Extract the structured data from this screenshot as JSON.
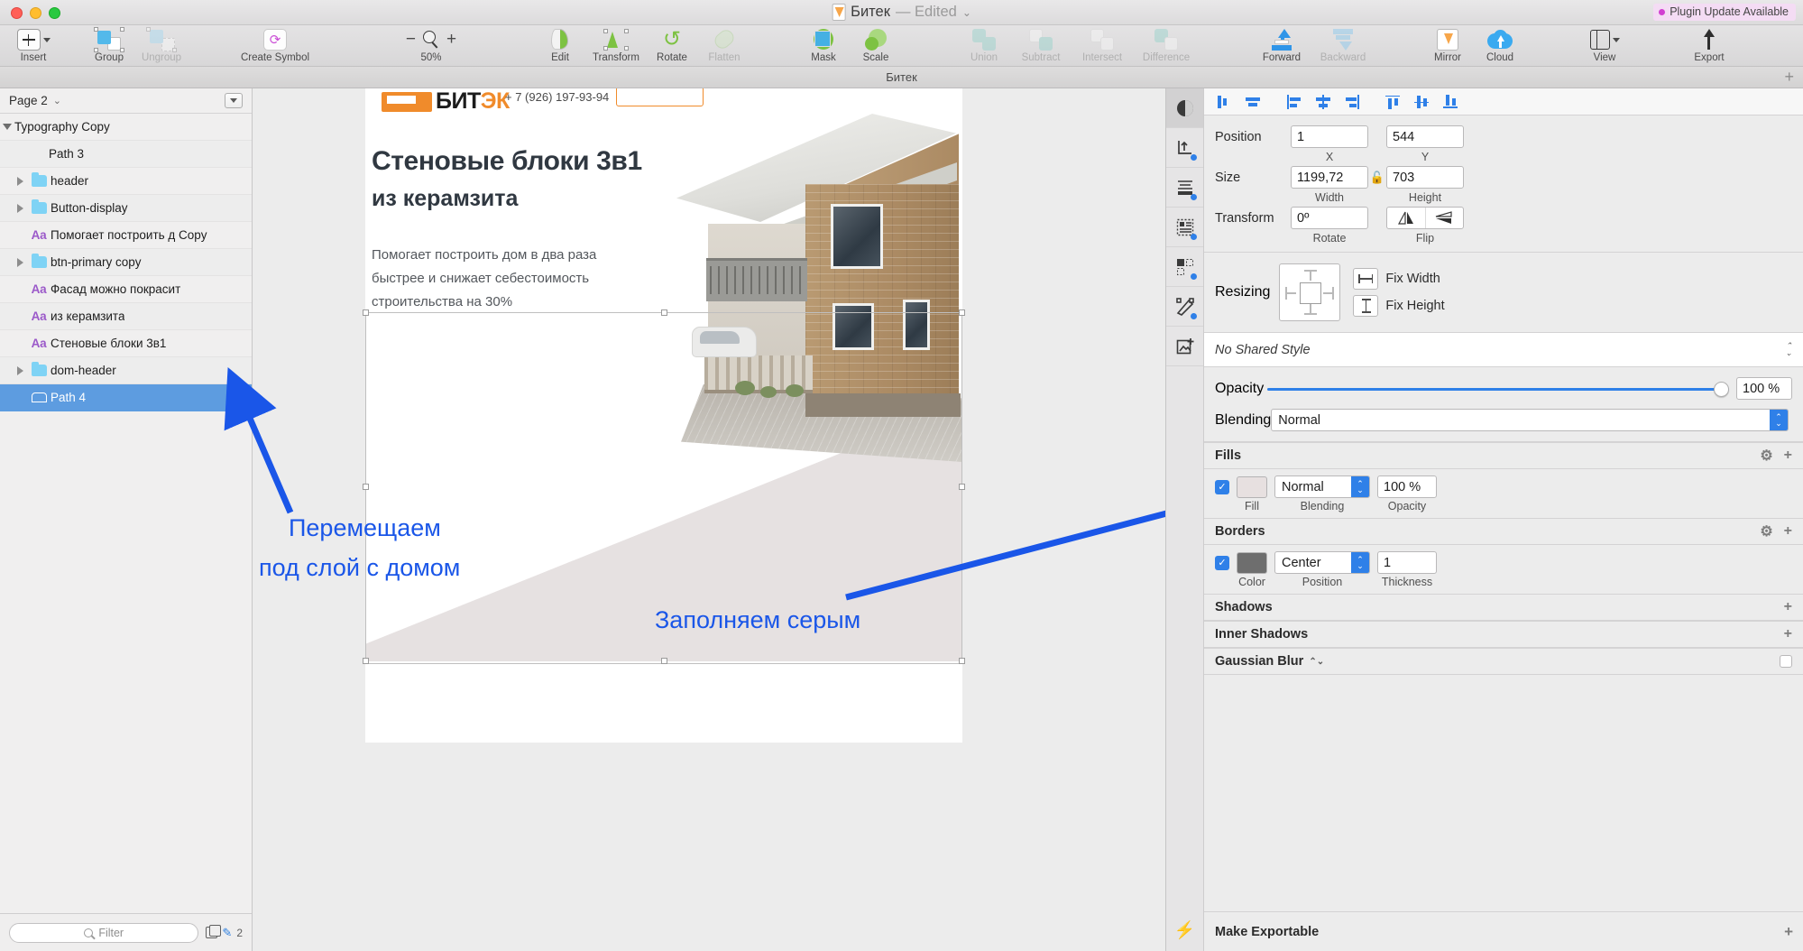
{
  "window": {
    "document_title": "Битек",
    "edited_label": "— Edited",
    "plugin_badge": "Plugin Update Available",
    "tab_label": "Битек"
  },
  "toolbar": {
    "items": [
      {
        "label": "Insert",
        "icon": "insert-plus-icon",
        "dim": false
      },
      {
        "label": "Group",
        "icon": "group-icon",
        "dim": false
      },
      {
        "label": "Ungroup",
        "icon": "ungroup-icon",
        "dim": true
      },
      {
        "label": "Create Symbol",
        "icon": "create-symbol-icon",
        "dim": false
      },
      {
        "label": "50%",
        "icon": "zoom-loupe-icon",
        "dim": false
      },
      {
        "label": "Edit",
        "icon": "edit-leaf-icon",
        "dim": false
      },
      {
        "label": "Transform",
        "icon": "transform-icon",
        "dim": false
      },
      {
        "label": "Rotate",
        "icon": "rotate-icon",
        "dim": false
      },
      {
        "label": "Flatten",
        "icon": "flatten-icon",
        "dim": true
      },
      {
        "label": "Mask",
        "icon": "mask-icon",
        "dim": false
      },
      {
        "label": "Scale",
        "icon": "scale-icon",
        "dim": false
      },
      {
        "label": "Union",
        "icon": "union-icon",
        "dim": true
      },
      {
        "label": "Subtract",
        "icon": "subtract-icon",
        "dim": true
      },
      {
        "label": "Intersect",
        "icon": "intersect-icon",
        "dim": true
      },
      {
        "label": "Difference",
        "icon": "difference-icon",
        "dim": true
      },
      {
        "label": "Forward",
        "icon": "forward-icon",
        "dim": false
      },
      {
        "label": "Backward",
        "icon": "backward-icon",
        "dim": true
      },
      {
        "label": "Mirror",
        "icon": "mirror-icon",
        "dim": false
      },
      {
        "label": "Cloud",
        "icon": "cloud-icon",
        "dim": false
      },
      {
        "label": "View",
        "icon": "view-icon",
        "dim": false
      },
      {
        "label": "Export",
        "icon": "export-icon",
        "dim": false
      }
    ],
    "zoom_level": "50%"
  },
  "sidebar": {
    "page_name": "Page 2",
    "filter_placeholder": "Filter",
    "filter_count": "2",
    "layers": [
      {
        "name": "Typography Copy",
        "type": "group",
        "expanded": true,
        "indent": 0,
        "selected": false
      },
      {
        "name": "Path 3",
        "type": "path-plain",
        "expanded": null,
        "indent": 1,
        "selected": false
      },
      {
        "name": "header",
        "type": "folder",
        "expanded": false,
        "indent": 1,
        "selected": false
      },
      {
        "name": "Button-display",
        "type": "folder",
        "expanded": false,
        "indent": 1,
        "selected": false
      },
      {
        "name": "Помогает построить д Copy",
        "type": "text",
        "expanded": null,
        "indent": 1,
        "selected": false
      },
      {
        "name": "btn-primary copy",
        "type": "folder",
        "expanded": false,
        "indent": 1,
        "selected": false
      },
      {
        "name": "Фасад можно покрасит",
        "type": "text",
        "expanded": null,
        "indent": 1,
        "selected": false
      },
      {
        "name": "из керамзита",
        "type": "text",
        "expanded": null,
        "indent": 1,
        "selected": false
      },
      {
        "name": "Стеновые блоки 3в1",
        "type": "text",
        "expanded": null,
        "indent": 1,
        "selected": false
      },
      {
        "name": "dom-header",
        "type": "folder",
        "expanded": false,
        "indent": 1,
        "selected": false
      },
      {
        "name": "Path 4",
        "type": "shape",
        "expanded": null,
        "indent": 1,
        "selected": true
      }
    ]
  },
  "canvas": {
    "artboard": {
      "logo_text_plain": "БИТ",
      "logo_text_accent": "ЭК",
      "phone": "+ 7 (926) 197-93-94",
      "heading": "Стеновые блоки 3в1",
      "subheading": "из керамзита",
      "paragraph": "Помогает построить дом в два раза быстрее и снижает себестоимость строительства на 30%"
    },
    "annotations": [
      {
        "text": "Перемещаем",
        "color": "#1a56e8"
      },
      {
        "text": "под слой с домом",
        "color": "#1a56e8"
      },
      {
        "text": "Заполняем серым",
        "color": "#1a56e8"
      }
    ]
  },
  "inspector": {
    "position": {
      "label": "Position",
      "x": "1",
      "y": "544",
      "x_sub": "X",
      "y_sub": "Y"
    },
    "size": {
      "label": "Size",
      "width": "1199,72",
      "height": "703",
      "width_sub": "Width",
      "height_sub": "Height"
    },
    "transform": {
      "label": "Transform",
      "rotate": "0º",
      "rotate_sub": "Rotate",
      "flip_sub": "Flip"
    },
    "resizing": {
      "label": "Resizing",
      "fix_width": "Fix Width",
      "fix_height": "Fix Height"
    },
    "shared_style": "No Shared Style",
    "opacity": {
      "label": "Opacity",
      "value": "100 %"
    },
    "blending": {
      "label": "Blending",
      "value": "Normal"
    },
    "fills": {
      "title": "Fills",
      "blending": "Normal",
      "opacity": "100 %",
      "sub_fill": "Fill",
      "sub_blending": "Blending",
      "sub_opacity": "Opacity",
      "color": "#e7e0e0"
    },
    "borders": {
      "title": "Borders",
      "position": "Center",
      "thickness": "1",
      "sub_color": "Color",
      "sub_position": "Position",
      "sub_thickness": "Thickness",
      "color": "#6e6e6e"
    },
    "shadows_title": "Shadows",
    "inner_shadows_title": "Inner Shadows",
    "gaussian_blur_title": "Gaussian Blur",
    "make_exportable": "Make Exportable"
  }
}
